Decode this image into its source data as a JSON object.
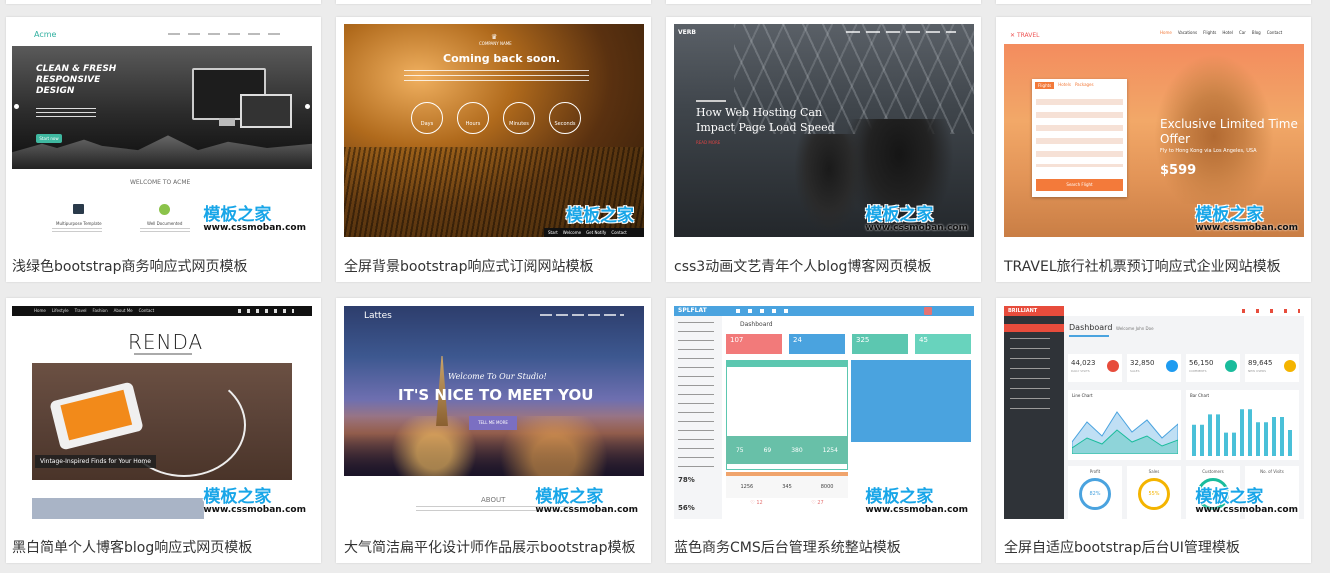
{
  "watermark": {
    "cn": "模板之家",
    "url": "www.cssmoban.com"
  },
  "cards": [
    {
      "caption": "浅绿色bootstrap商务响应式网页模板",
      "brand": "Acme",
      "hero_title": "CLEAN & FRESH RESPONSIVE DESIGN",
      "button": "Start now",
      "welcome": "WELCOME TO ACME",
      "feat1": "Multipurpose Template",
      "feat2": "Well Documented"
    },
    {
      "caption": "全屏背景bootstrap响应式订阅网站模板",
      "company": "COMPANY NAME",
      "title": "Coming back soon.",
      "counters": [
        "Days",
        "Hours",
        "Minutes",
        "Seconds"
      ],
      "bottom_nav": [
        "Start",
        "Welcome",
        "Get Notify",
        "Contact"
      ]
    },
    {
      "caption": "css3动画文艺青年个人blog博客网页模板",
      "logo": "VERB",
      "headline_1": "How Web Hosting Can",
      "headline_2": "Impact Page Load Speed",
      "read_more": "READ MORE"
    },
    {
      "caption": "TRAVEL旅行社机票预订响应式企业网站模板",
      "logo": "TRAVEL",
      "nav": [
        "Home",
        "Vacations",
        "Flights",
        "Hotel",
        "Car",
        "Blog",
        "Contact"
      ],
      "tabs": [
        "Flights",
        "Hotels",
        "Packages"
      ],
      "offer_1": "Exclusive Limited Time",
      "offer_2": "Offer",
      "route": "Fly to Hong Kong via Los Angeles, USA",
      "price": "$599",
      "search_button": "Search Flight"
    },
    {
      "caption": "黑白简单个人博客blog响应式网页模板",
      "nav": [
        "Home",
        "Lifestyle",
        "Travel",
        "Fashion",
        "About Me",
        "Contact"
      ],
      "logo": "RENDA",
      "post_title": "Vintage-Inspired Finds for Your Home"
    },
    {
      "caption": "大气简洁扁平化设计师作品展示bootstrap模板",
      "logo": "Lattes",
      "welcome": "Welcome To Our Studio!",
      "headline": "IT'S NICE TO MEET YOU",
      "button": "TELL ME MORE",
      "about": "ABOUT"
    },
    {
      "caption": "蓝色商务CMS后台管理系统整站模板",
      "logo": "SPLFLAT",
      "page_title": "Dashboard",
      "stats": [
        "107",
        "24",
        "325",
        "45"
      ],
      "mini_stats": [
        "75",
        "69",
        "380",
        "1254"
      ],
      "percent_1": "78%",
      "percent_2": "56%",
      "row_vals": [
        "1256",
        "345",
        "8000"
      ],
      "likes": [
        "12",
        "27"
      ]
    },
    {
      "caption": "全屏自适应bootstrap后台UI管理模板",
      "logo": "BRILLIANT",
      "page_title": "Dashboard",
      "welcome": "Welcome John Doe",
      "stats": [
        "44,023",
        "32,850",
        "56,150",
        "89,645"
      ],
      "stat_labels": [
        "DAILY VISITS",
        "SALES",
        "COMMENTS",
        "NEW USERS"
      ],
      "chart_1": "Line Chart",
      "chart_2": "Bar Chart",
      "gauges": [
        {
          "label": "Profit",
          "value": "82%"
        },
        {
          "label": "Sales",
          "value": "55%"
        },
        {
          "label": "Customers",
          "value": "84%"
        },
        {
          "label": "No. of Visits",
          "value": ""
        }
      ]
    }
  ]
}
